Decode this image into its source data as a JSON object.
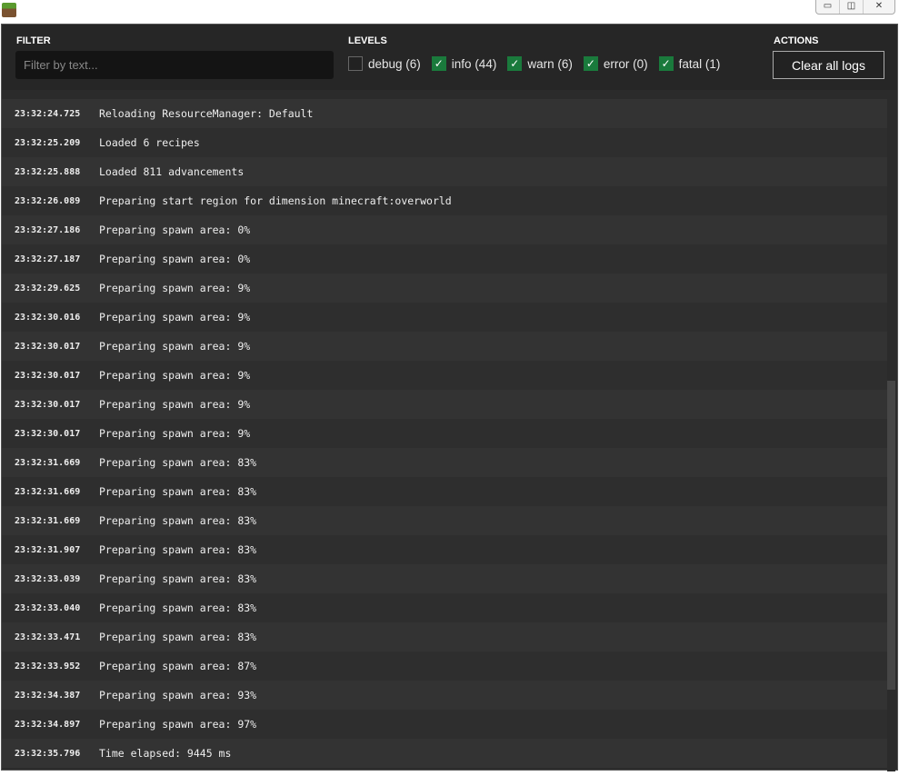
{
  "window": {
    "controls": [
      "▭",
      "◫",
      "✕"
    ]
  },
  "header": {
    "filter_label": "FILTER",
    "filter_placeholder": "Filter by text...",
    "filter_value": "",
    "levels_label": "LEVELS",
    "actions_label": "ACTIONS",
    "clear_label": "Clear all logs",
    "levels": [
      {
        "label": "debug (6)",
        "checked": false
      },
      {
        "label": "info (44)",
        "checked": true
      },
      {
        "label": "warn (6)",
        "checked": true
      },
      {
        "label": "error (0)",
        "checked": true
      },
      {
        "label": "fatal (1)",
        "checked": true
      }
    ]
  },
  "logs": [
    {
      "time": "23:32:24.725",
      "msg": "Reloading ResourceManager: Default"
    },
    {
      "time": "23:32:25.209",
      "msg": "Loaded 6 recipes"
    },
    {
      "time": "23:32:25.888",
      "msg": "Loaded 811 advancements"
    },
    {
      "time": "23:32:26.089",
      "msg": "Preparing start region for dimension minecraft:overworld"
    },
    {
      "time": "23:32:27.186",
      "msg": "Preparing spawn area: 0%"
    },
    {
      "time": "23:32:27.187",
      "msg": "Preparing spawn area: 0%"
    },
    {
      "time": "23:32:29.625",
      "msg": "Preparing spawn area: 9%"
    },
    {
      "time": "23:32:30.016",
      "msg": "Preparing spawn area: 9%"
    },
    {
      "time": "23:32:30.017",
      "msg": "Preparing spawn area: 9%"
    },
    {
      "time": "23:32:30.017",
      "msg": "Preparing spawn area: 9%"
    },
    {
      "time": "23:32:30.017",
      "msg": "Preparing spawn area: 9%"
    },
    {
      "time": "23:32:30.017",
      "msg": "Preparing spawn area: 9%"
    },
    {
      "time": "23:32:31.669",
      "msg": "Preparing spawn area: 83%"
    },
    {
      "time": "23:32:31.669",
      "msg": "Preparing spawn area: 83%"
    },
    {
      "time": "23:32:31.669",
      "msg": "Preparing spawn area: 83%"
    },
    {
      "time": "23:32:31.907",
      "msg": "Preparing spawn area: 83%"
    },
    {
      "time": "23:32:33.039",
      "msg": "Preparing spawn area: 83%"
    },
    {
      "time": "23:32:33.040",
      "msg": "Preparing spawn area: 83%"
    },
    {
      "time": "23:32:33.471",
      "msg": "Preparing spawn area: 83%"
    },
    {
      "time": "23:32:33.952",
      "msg": "Preparing spawn area: 87%"
    },
    {
      "time": "23:32:34.387",
      "msg": "Preparing spawn area: 93%"
    },
    {
      "time": "23:32:34.897",
      "msg": "Preparing spawn area: 97%"
    },
    {
      "time": "23:32:35.796",
      "msg": "Time elapsed: 9445 ms"
    }
  ]
}
